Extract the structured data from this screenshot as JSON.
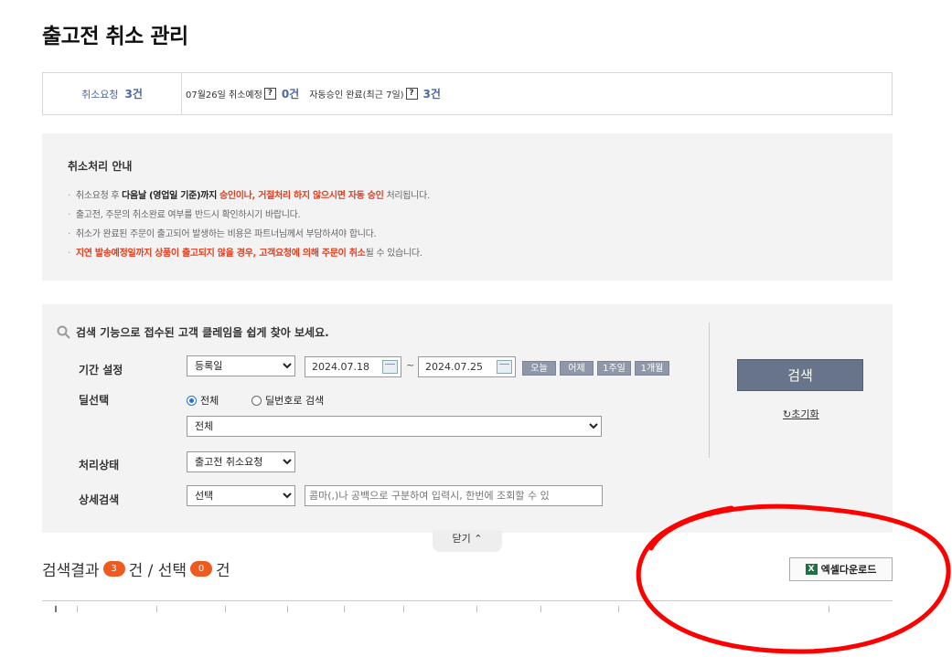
{
  "page": {
    "title": "출고전 취소 관리"
  },
  "summary": {
    "request_label": "취소요청",
    "request_count": "3건",
    "date_label": "07월26일 취소예정",
    "help_glyph": "?",
    "scheduled_count": "0건",
    "auto_label": "자동승인 완료(최근 7일)",
    "auto_count": "3건"
  },
  "guide": {
    "title": "취소처리 안내",
    "line1_a": "취소요청 후 ",
    "line1_b": "다음날 (영업일 기준)까지",
    "line1_c": "승인이나, 거절처리 하지 않으시면 자동 승인",
    "line1_d": " 처리됩니다.",
    "line2": "출고전, 주문의 취소완료 여부를 반드시 확인하시기 바랍니다.",
    "line3": "취소가 완료된 주문이 출고되어 발생하는 비용은 파트너님께서 부담하셔야 합니다.",
    "line4_a": "지연 발송예정일까지",
    "line4_b": "상품이 출고되지 않을 경우, 고객요청에 의해 주문이 취소",
    "line4_c": "될 수 있습니다."
  },
  "search": {
    "heading": "검색 기능으로 접수된 고객 클레임을 쉽게 찾아 보세요.",
    "period_label": "기간 설정",
    "period_type": "등록일",
    "date_from": "2024.07.18",
    "tilde": "~",
    "date_to": "2024.07.25",
    "quick": [
      "오늘",
      "어제",
      "1주일",
      "1개월"
    ],
    "deal_label": "딜선택",
    "radio_all": "전체",
    "radio_deal": "딜번호로 검색",
    "deal_select": "전체",
    "status_label": "처리상태",
    "status_value": "출고전 취소요청",
    "detail_label": "상세검색",
    "detail_value": "선택",
    "detail_placeholder": "콤마(,)나 공백으로 구분하여 입력시, 한번에 조회할 수 있",
    "search_button": "검색",
    "reset_link": "초기화",
    "reset_glyph": "↻",
    "close_label": "닫기",
    "close_glyph": "⌃"
  },
  "results": {
    "label": "검색결과",
    "count": "3",
    "unit1": "건 / 선택",
    "selected": "0",
    "unit2": "건",
    "excel_button": "엑셀다운로드",
    "excel_glyph": "X"
  },
  "colors": {
    "accent": "#f05a1e",
    "link_blue": "#4a67a8",
    "annotation": "#ff0000"
  }
}
